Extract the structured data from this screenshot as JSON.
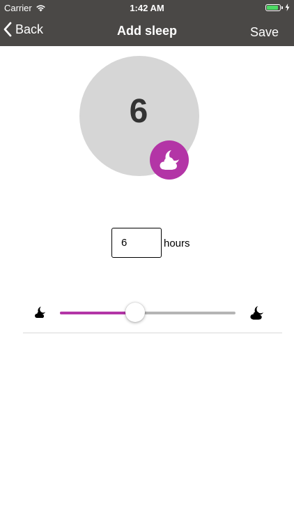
{
  "status_bar": {
    "carrier": "Carrier",
    "time": "1:42 AM",
    "battery_color": "#4cd964"
  },
  "nav": {
    "back_label": "Back",
    "title": "Add sleep",
    "save_label": "Save"
  },
  "display": {
    "hours_value": "6",
    "badge_icon": "cloud-moon-icon",
    "circle_color": "#d6d6d6",
    "badge_color": "#b335a6"
  },
  "input": {
    "value": "6",
    "unit_label": "hours"
  },
  "slider": {
    "min_icon": "cloud-moon-small-icon",
    "max_icon": "cloud-moon-large-icon",
    "fraction": 0.43,
    "accent_color": "#b335a6",
    "track_color": "#b5b5b5"
  }
}
